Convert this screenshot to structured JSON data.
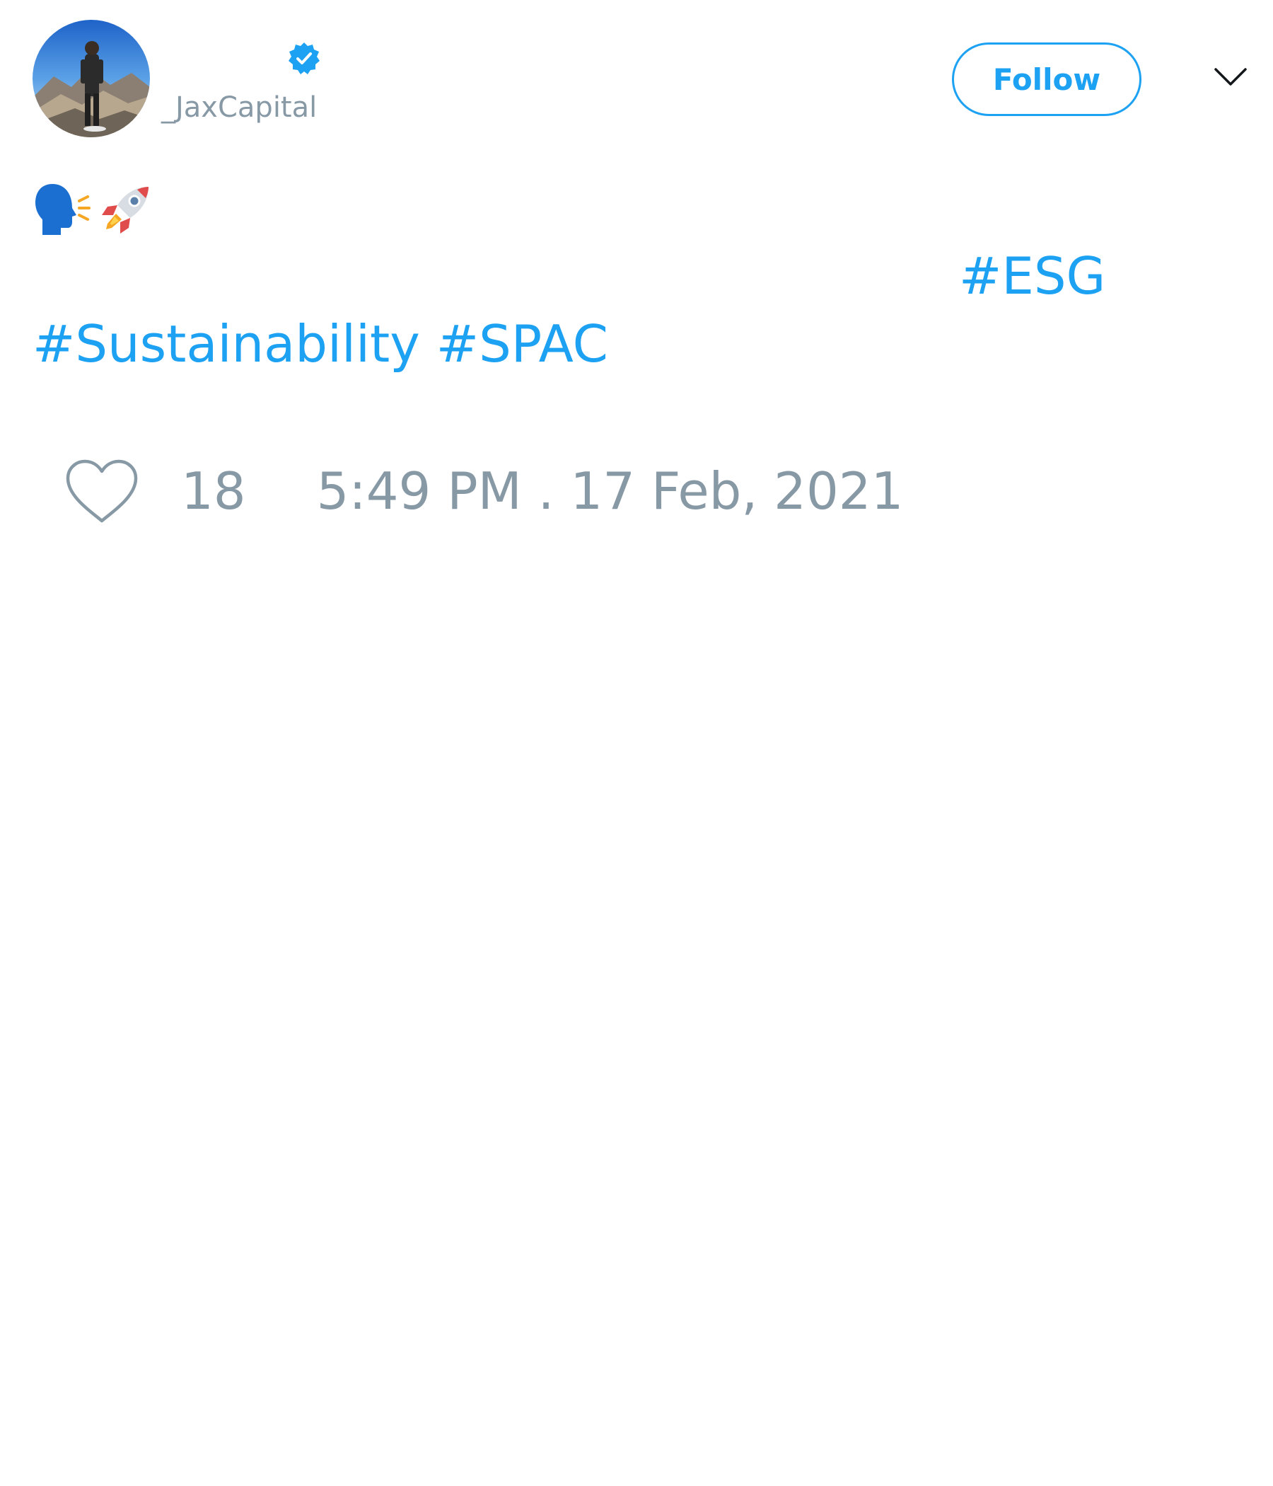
{
  "author": {
    "display_name": "",
    "handle": "_JaxCapital",
    "verified": true,
    "avatar_icon": "avatar-photo"
  },
  "header": {
    "follow_label": "Follow",
    "menu_icon": "chevron-down-icon"
  },
  "tweet": {
    "emojis": [
      "speaking-head-icon",
      "rocket-icon"
    ],
    "hashtags": [
      "#ESG",
      "#Sustainability",
      "#SPAC"
    ]
  },
  "footer": {
    "like_count": "18",
    "timestamp": "5:49 PM . 17 Feb, 2021"
  },
  "colors": {
    "accent": "#1da1f2",
    "muted": "#8899a6",
    "text": "#14171a"
  }
}
